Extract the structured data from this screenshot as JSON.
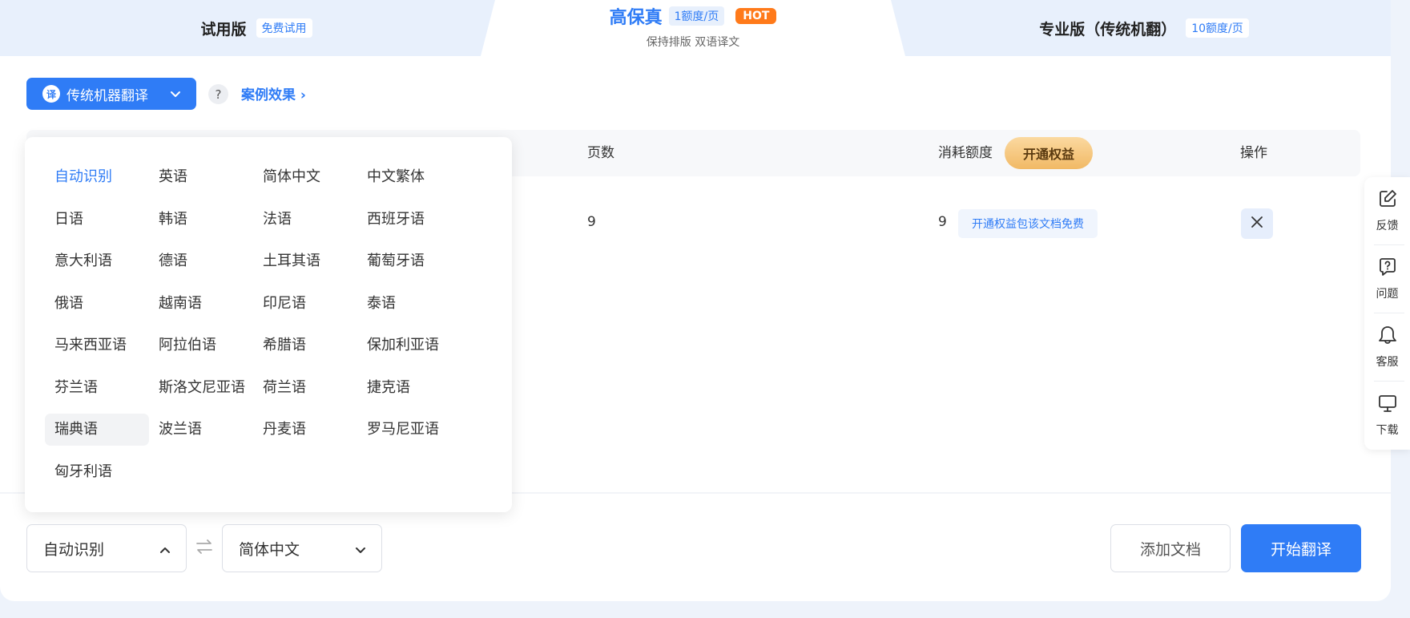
{
  "tabs": {
    "trial": {
      "title": "试用版",
      "badge": "免费试用"
    },
    "high_fidelity": {
      "title": "高保真",
      "quota": "1额度/页",
      "hot": "HOT",
      "subtitle": "保持排版 双语译文"
    },
    "pro": {
      "title": "专业版（传统机翻）",
      "quota": "10额度/页"
    }
  },
  "mode": {
    "icon_text": "译",
    "label": "传统机器翻译"
  },
  "case_link": "案例效果 ›",
  "help": "?",
  "table": {
    "headers": {
      "pages": "页数",
      "quota": "消耗额度",
      "actions": "操作"
    },
    "open_benefit": "开通权益",
    "row": {
      "pages": "9",
      "quota": "9",
      "free_note": "开通权益包该文档免费"
    }
  },
  "languages": [
    [
      "自动识别",
      "英语",
      "简体中文",
      "中文繁体"
    ],
    [
      "日语",
      "韩语",
      "法语",
      "西班牙语"
    ],
    [
      "意大利语",
      "德语",
      "土耳其语",
      "葡萄牙语"
    ],
    [
      "俄语",
      "越南语",
      "印尼语",
      "泰语"
    ],
    [
      "马来西亚语",
      "阿拉伯语",
      "希腊语",
      "保加利亚语"
    ],
    [
      "芬兰语",
      "斯洛文尼亚语",
      "荷兰语",
      "捷克语"
    ],
    [
      "瑞典语",
      "波兰语",
      "丹麦语",
      "罗马尼亚语"
    ],
    [
      "匈牙利语"
    ]
  ],
  "language_state": {
    "active": "自动识别",
    "hover": "瑞典语"
  },
  "bottom": {
    "source": "自动识别",
    "target": "简体中文",
    "add_doc": "添加文档",
    "start": "开始翻译"
  },
  "sidebar": [
    {
      "icon": "edit-icon",
      "label": "反馈"
    },
    {
      "icon": "question-icon",
      "label": "问题"
    },
    {
      "icon": "customer-service-icon",
      "label": "客服"
    },
    {
      "icon": "monitor-icon",
      "label": "下载"
    }
  ],
  "colors": {
    "primary": "#2f7cf6",
    "hot": "#ff7a1a",
    "benefit": "#f1b965"
  }
}
